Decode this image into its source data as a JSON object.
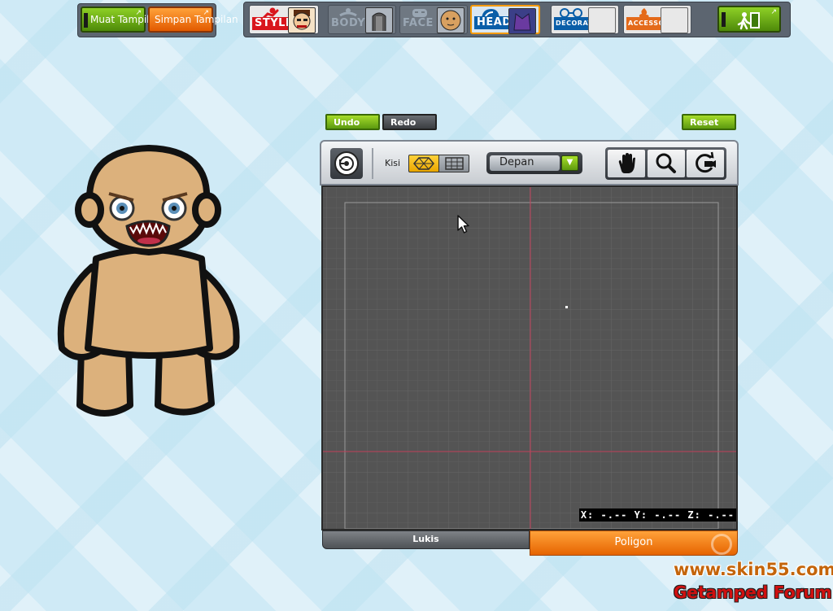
{
  "toolbar": {
    "load_label": "Muat Tampilan",
    "save_label": "Simpan Tampilan",
    "categories": [
      {
        "id": "style",
        "label": "STYLE"
      },
      {
        "id": "body",
        "label": "BODY"
      },
      {
        "id": "face",
        "label": "FACE"
      },
      {
        "id": "head",
        "label": "HEAD",
        "selected": true
      },
      {
        "id": "decoration",
        "label": "DECORATION"
      },
      {
        "id": "accessory",
        "label": "ACCESSORY"
      }
    ],
    "exit_icon": "exit-door-icon"
  },
  "editor": {
    "undo_label": "Undo",
    "redo_label": "Redo",
    "reset_label": "Reset",
    "grid_label": "Kisi",
    "grid_options": [
      "hexagon",
      "square"
    ],
    "grid_selected": "hexagon",
    "view_value": "Depan",
    "nav_tools": [
      "hand-icon",
      "magnify-icon",
      "rotate-camera-icon"
    ],
    "coord_readout": "X: -.-- Y: -.-- Z: -.--",
    "tabs": [
      {
        "label": "Lukis",
        "active": false
      },
      {
        "label": "Poligon",
        "active": true
      }
    ]
  },
  "watermark": {
    "url": "www.skin55.com",
    "forum": "Getamped Forum"
  },
  "colors": {
    "accent_green": "#6fb018",
    "accent_orange": "#f07a10",
    "canvas_bg": "#545454",
    "axis_line": "#c0405a",
    "head_highlight": "#f59a00"
  }
}
